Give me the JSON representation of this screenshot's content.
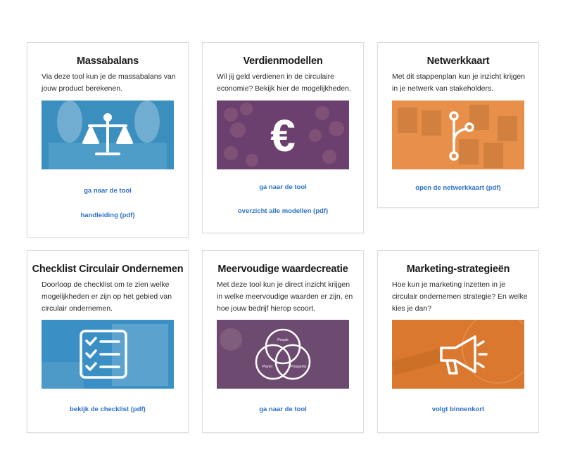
{
  "cards": [
    {
      "title": "Massabalans",
      "description": "Via deze tool kun je de massabalans van jouw product berekenen.",
      "image_icon": "scale-icon",
      "links": [
        "ga naar de tool",
        "handleiding (pdf)"
      ]
    },
    {
      "title": "Verdienmodellen",
      "description": "Wil jij geld verdienen in de circulaire economie? Bekijk hier de mogelijkheden.",
      "image_icon": "euro-icon",
      "links": [
        "ga naar de tool",
        "overzicht alle modellen (pdf)"
      ]
    },
    {
      "title": "Netwerkkaart",
      "description": "Met dit stappenplan kun je inzicht krijgen in je netwerk van stakeholders.",
      "image_icon": "network-branch-icon",
      "links": [
        "open de netwerkkaart (pdf)"
      ]
    },
    {
      "title": "Checklist Circulair Ondernemen",
      "description": "Doorloop de checklist om te zien welke mogelijkheden er zijn op het gebied van circulair ondernemen.",
      "image_icon": "checklist-icon",
      "links": [
        "bekijk de checklist (pdf)"
      ]
    },
    {
      "title": "Meervoudige waardecreatie",
      "description": "Met deze tool kun je direct inzicht krijgen in welke meervoudige waarden er zijn, en hoe jouw bedrijf hierop scoort.",
      "image_icon": "venn-diagram-icon",
      "venn_labels": [
        "People",
        "Planet",
        "Prosperity"
      ],
      "links": [
        "ga naar de tool"
      ]
    },
    {
      "title": "Marketing-strategieën",
      "description": "Hoe kun je marketing inzetten in je circulair ondernemen strategie? En welke kies je dan?",
      "image_icon": "megaphone-icon",
      "links": [
        "volgt binnenkort"
      ]
    }
  ],
  "colors": {
    "link": "#2b6fc9",
    "massabalans_overlay": "#3a8fbf",
    "verdienmodellen_overlay": "#6b3f6e",
    "netwerkkaart_overlay": "#e8904a",
    "checklist_overlay": "#3a8fc4",
    "waardecreatie_overlay": "#6d4a6f",
    "marketing_overlay": "#d9782e"
  }
}
